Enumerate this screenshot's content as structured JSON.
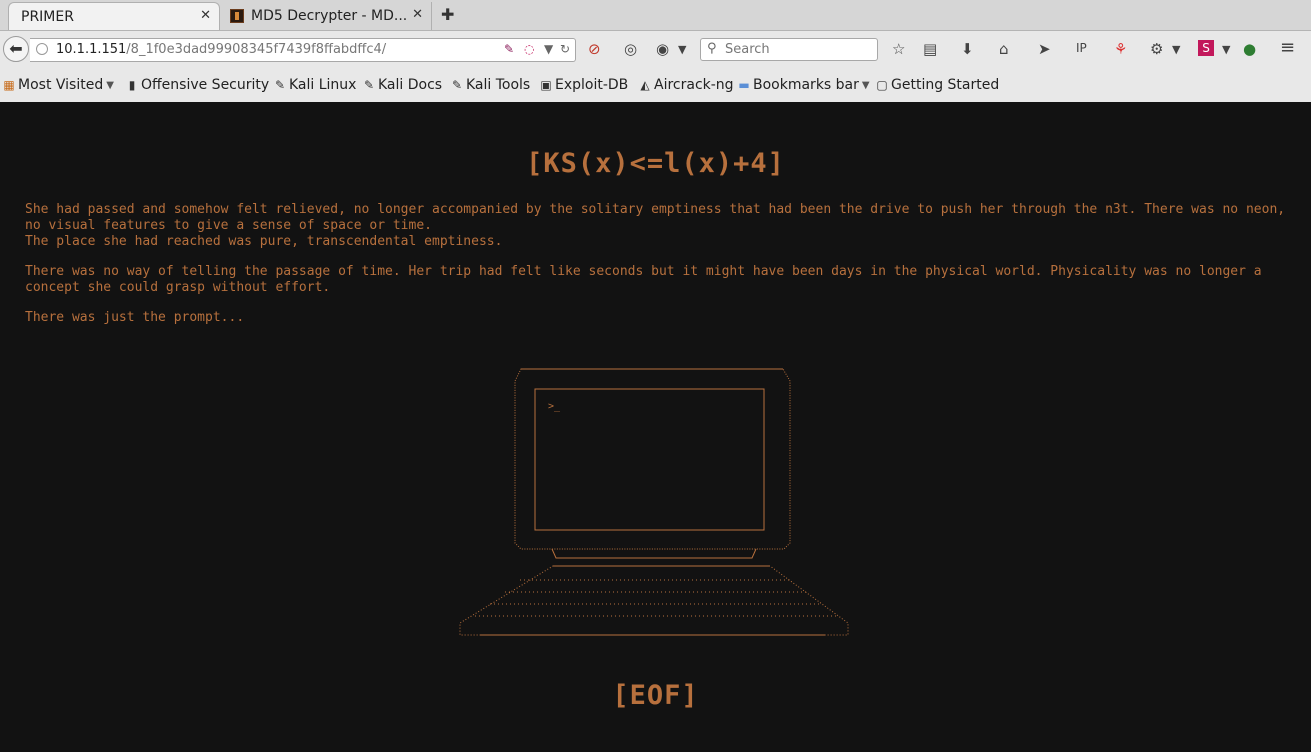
{
  "tabs": [
    {
      "title": "PRIMER",
      "active": true
    },
    {
      "title": "MD5 Decrypter - MD...",
      "active": false
    }
  ],
  "toolbar": {
    "url_host": "10.1.1.151",
    "url_path": "/8_1f0e3dad99908345f7439f8ffabdffc4/",
    "search_placeholder": "Search"
  },
  "bookmarks": [
    {
      "label": "Most Visited",
      "icon": "most-visited-icon",
      "dropdown": true
    },
    {
      "label": "Offensive Security",
      "icon": "offsec-icon"
    },
    {
      "label": "Kali Linux",
      "icon": "kali-icon"
    },
    {
      "label": "Kali Docs",
      "icon": "kali-icon"
    },
    {
      "label": "Kali Tools",
      "icon": "kali-icon"
    },
    {
      "label": "Exploit-DB",
      "icon": "exploitdb-icon"
    },
    {
      "label": "Aircrack-ng",
      "icon": "aircrack-icon"
    },
    {
      "label": "Bookmarks bar",
      "icon": "folder-icon",
      "dropdown": true
    },
    {
      "label": "Getting Started",
      "icon": "page-icon"
    }
  ],
  "page": {
    "title": "[KS(x)<=l(x)+4]",
    "paragraphs": [
      "She had passed and somehow felt relieved, no longer accompanied by the solitary emptiness that had been the drive to push her through the n3t. There was no neon, no visual features to give a sense of space or time.\nThe place she had reached was pure, transcendental emptiness.",
      "There was no way of telling the passage of time. Her trip had felt like seconds but it might have been days in the physical world. Physicality was no longer a concept she could grasp without effort.",
      "There was just the prompt..."
    ],
    "prompt": ">_",
    "eof": "[EOF]"
  },
  "colors": {
    "background": "#121212",
    "text": "#b7703d"
  }
}
